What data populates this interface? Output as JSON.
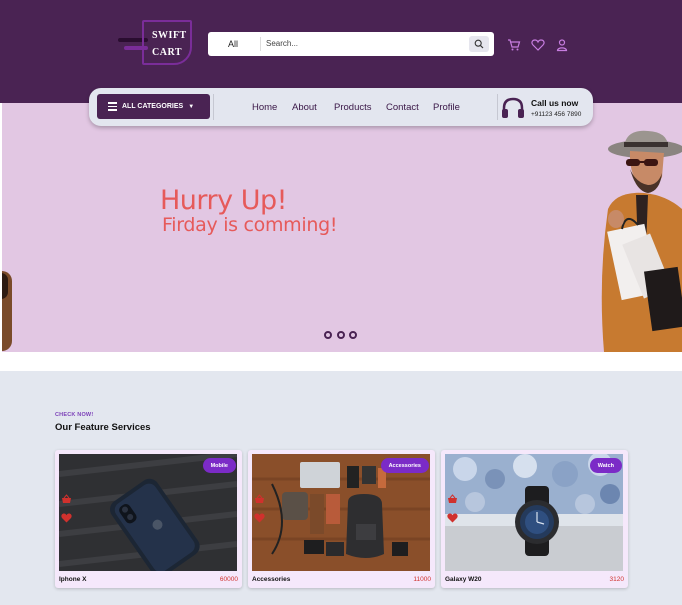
{
  "brand": {
    "line1": "SWIFT",
    "line2": "CART"
  },
  "search": {
    "category": "All",
    "placeholder": "Search..."
  },
  "nav": {
    "categories_label": "ALL CATEGORIES",
    "links": [
      "Home",
      "About",
      "Products",
      "Contact",
      "Profile"
    ],
    "call_title": "Call us now",
    "call_phone": "+91123 456 7890"
  },
  "hero": {
    "title": "Hurry Up!",
    "subtitle": "Firday is comming!",
    "slides": 3
  },
  "features": {
    "eyebrow": "CHECK NOW!",
    "title": "Our Feature Services",
    "cards": [
      {
        "tag": "Mobile",
        "name": "Iphone X",
        "price": "60000"
      },
      {
        "tag": "Accessories",
        "name": "Accessories",
        "price": "11000"
      },
      {
        "tag": "Watch",
        "name": "Galaxy W20",
        "price": "3120"
      }
    ]
  },
  "colors": {
    "header": "#4a2353",
    "hero_bg": "#e2c7e3",
    "accent_red": "#e65a5a",
    "tag_purple": "#7b2bc7"
  }
}
